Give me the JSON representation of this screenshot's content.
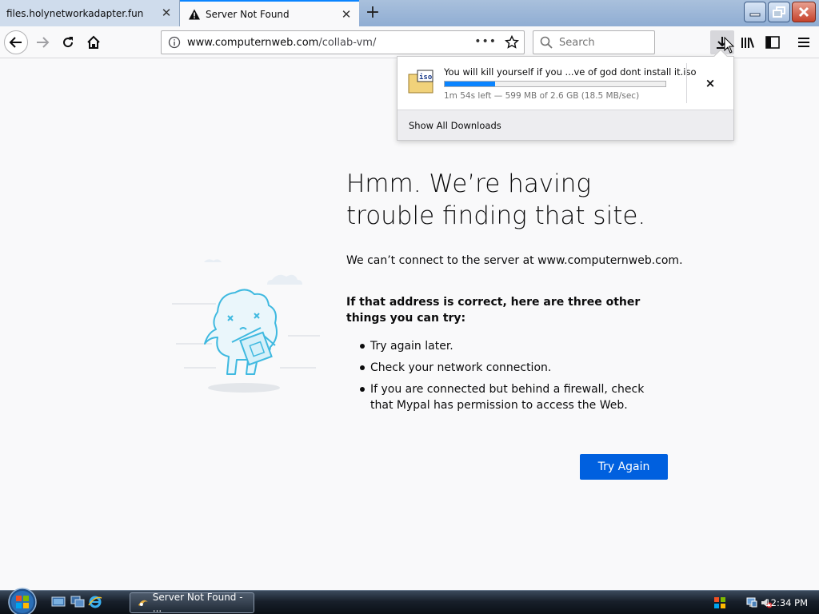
{
  "browser": {
    "tabs": [
      {
        "title": "files.holynetworkadapter.fun",
        "active": false
      },
      {
        "title": "Server Not Found",
        "active": true
      }
    ],
    "url": "www.computernweb.com/collab-vm/",
    "url_host": "www.computernweb.com",
    "url_path": "/collab-vm/",
    "search_placeholder": "Search",
    "page_actions": "•••"
  },
  "downloads_panel": {
    "file_name": "You will kill yourself if you ...ve of god dont install it.iso",
    "file_icon": "iso-file-icon",
    "icon_label": "iso",
    "progress_fraction": 0.23,
    "status": "1m 54s left — 599 MB of 2.6 GB (18.5 MB/sec)",
    "cancel_glyph": "×",
    "show_all": "Show All Downloads"
  },
  "error_page": {
    "title": "Hmm. We’re having trouble finding that site.",
    "message": "We can’t connect to the server at www.computernweb.com.",
    "tips_heading": "If that address is correct, here are three other things you can try:",
    "tips": [
      "Try again later.",
      "Check your network connection.",
      "If you are connected but behind a firewall, check that Mypal has permission to access the Web."
    ],
    "button": "Try Again"
  },
  "taskbar": {
    "window_button": "Server Not Found - ...",
    "clock": "12:34 PM"
  },
  "colors": {
    "accent": "#0a84ff",
    "button_blue": "#0060df",
    "page_bg": "#f9f9fa",
    "illustration": "#3fb9e0"
  }
}
